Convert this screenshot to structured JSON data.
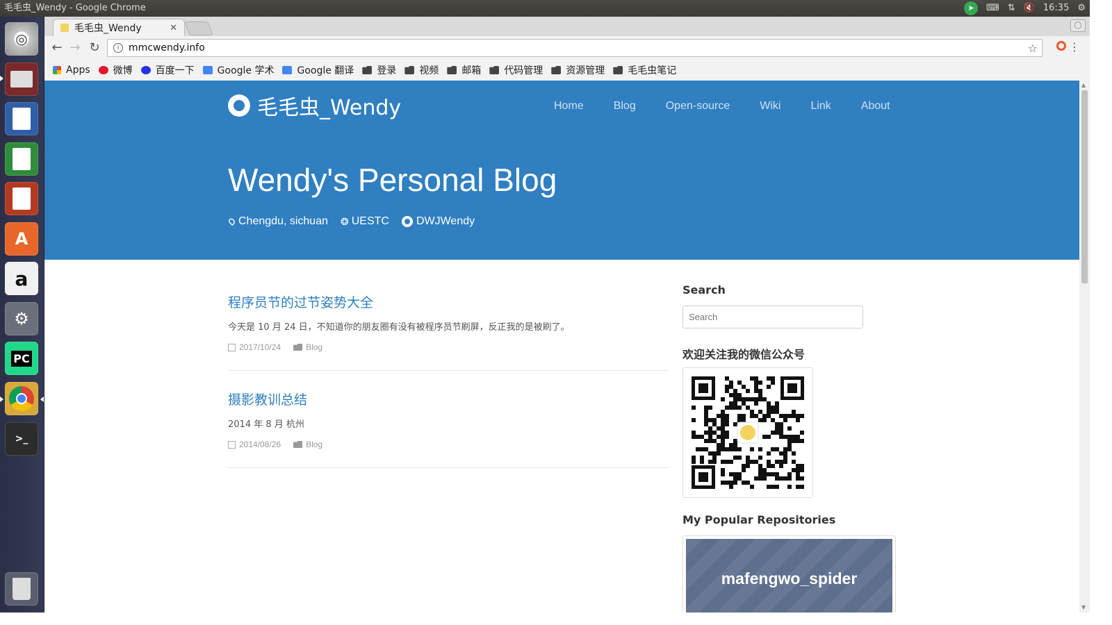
{
  "os": {
    "window_title": "毛毛虫_Wendy - Google Chrome",
    "clock": "16:35",
    "tray_icons": [
      "telegram-icon",
      "keyboard-icon",
      "network-icon",
      "volume-muted-icon",
      "settings-gear-icon"
    ],
    "launcher_apps": [
      "ubuntu-dash",
      "files",
      "libreoffice-writer",
      "libreoffice-calc",
      "libreoffice-impress",
      "ubuntu-software",
      "amazon",
      "system-settings",
      "pycharm",
      "chrome",
      "terminal",
      "trash"
    ]
  },
  "browser": {
    "tab_title": "毛毛虫_Wendy",
    "url": "mmcwendy.info",
    "bookmarks": [
      {
        "label": "Apps",
        "icon": "apps-grid-icon"
      },
      {
        "label": "微博",
        "icon": "weibo-icon"
      },
      {
        "label": "百度一下",
        "icon": "baidu-icon"
      },
      {
        "label": "Google 学术",
        "icon": "google-scholar-icon"
      },
      {
        "label": "Google 翻译",
        "icon": "google-translate-icon"
      },
      {
        "label": "登录",
        "icon": "folder-icon"
      },
      {
        "label": "视频",
        "icon": "folder-icon"
      },
      {
        "label": "邮箱",
        "icon": "folder-icon"
      },
      {
        "label": "代码管理",
        "icon": "folder-icon"
      },
      {
        "label": "资源管理",
        "icon": "folder-icon"
      },
      {
        "label": "毛毛虫笔记",
        "icon": "folder-icon"
      }
    ]
  },
  "site": {
    "brand": "毛毛虫_Wendy",
    "nav": [
      "Home",
      "Blog",
      "Open-source",
      "Wiki",
      "Link",
      "About"
    ],
    "hero_title": "Wendy's Personal Blog",
    "meta": {
      "location": "Chengdu, sichuan",
      "school": "UESTC",
      "github": "DWJWendy"
    },
    "posts": [
      {
        "title": "程序员节的过节姿势大全",
        "excerpt": "今天是 10 月 24 日，不知道你的朋友圈有没有被程序员节刷屏，反正我的是被刷了。",
        "date": "2017/10/24",
        "category": "Blog"
      },
      {
        "title": "摄影教训总结",
        "excerpt": "2014 年 8 月 杭州",
        "date": "2014/08/26",
        "category": "Blog"
      }
    ],
    "sidebar": {
      "search_heading": "Search",
      "search_placeholder": "Search",
      "wechat_heading": "欢迎关注我的微信公众号",
      "repos_heading": "My Popular Repositories",
      "repo_name": "mafengwo_spider"
    }
  },
  "colors": {
    "hero_bg": "#2f7fc1",
    "link": "#2f7fc1",
    "launcher_bg": "#2b2f48",
    "repo_card": "#5d6f8d"
  }
}
